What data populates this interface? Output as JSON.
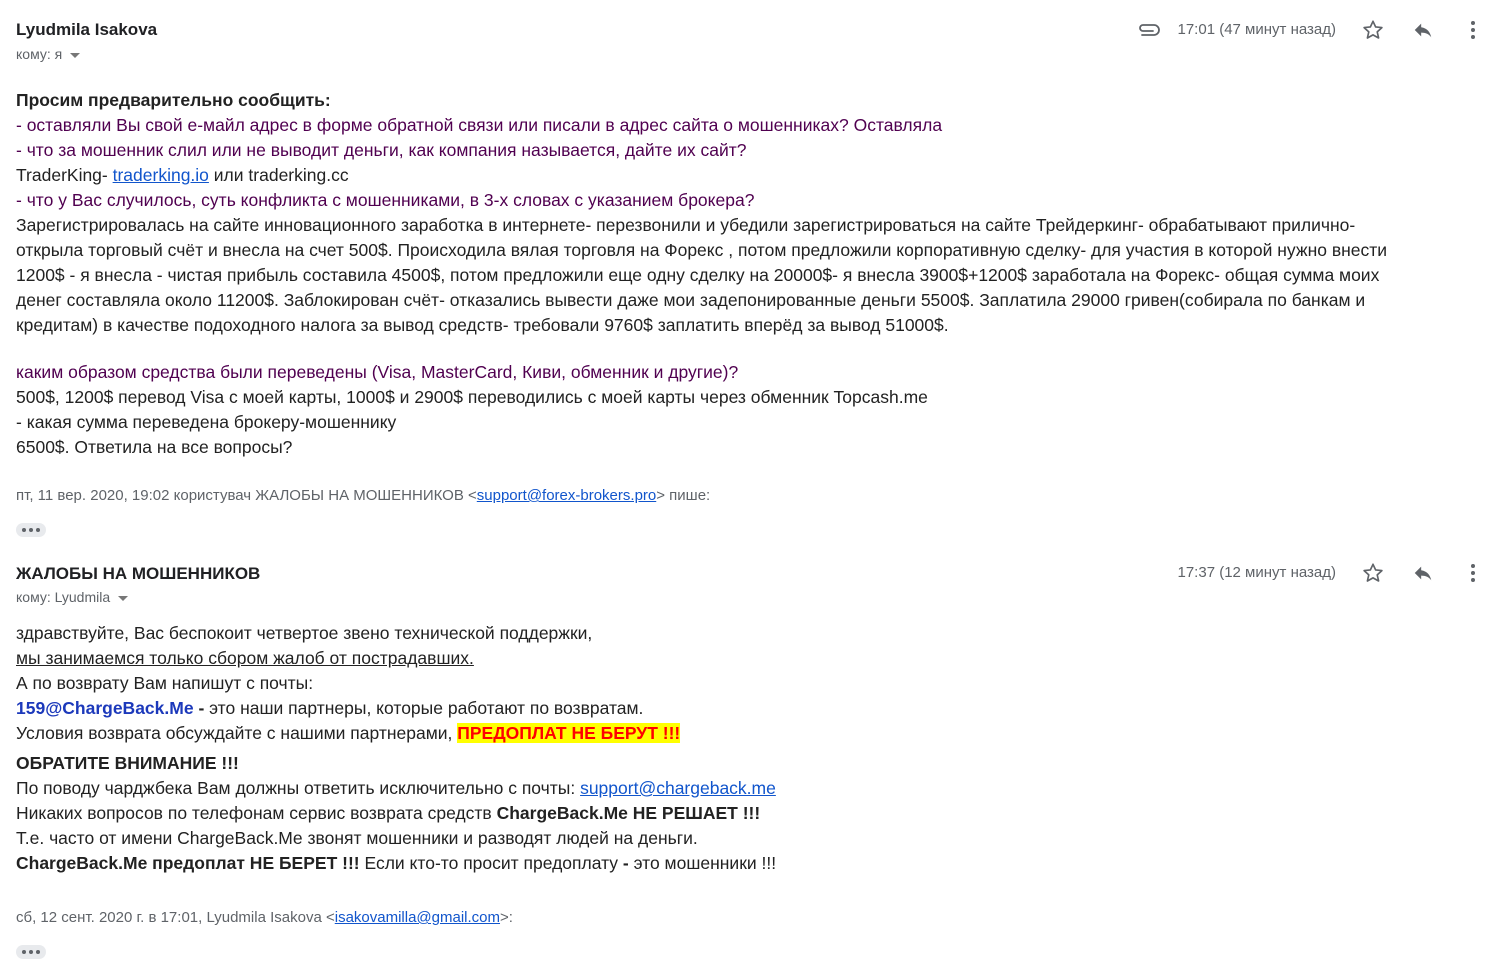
{
  "message1": {
    "sender": "Lyudmila Isakova",
    "recipient": "кому: я",
    "time": "17:01 (47 минут назад)",
    "icons": [
      "attachment-icon",
      "star-icon",
      "reply-icon",
      "more-vert-icon"
    ],
    "body": {
      "heading": "Просим предварительно сообщить:",
      "q1": " - оставляли Вы свой е-майл адрес в форме обратной связи или писали в адрес сайта о мошенниках? Оставляла",
      "q2": " - что за мошенник слил или не выводит деньги, как компания называется, дайте их сайт?",
      "a2_prefix": "TraderKing- ",
      "a2_link": "traderking.io",
      "a2_suffix": " или traderking.cc",
      "q3": " - что у Вас случилось, суть конфликта с мошенниками, в 3-х словах с указанием брокера?",
      "p1": "Зарегистрировалась на сайте инновационного заработка в интернете- перезвонили и убедили зарегистрироваться на сайте Трейдеркинг- обрабатывают прилично-",
      "p2": "открыла торговый счёт и внесла на счет 500$. Происходила вялая торговля на Форекс , потом предложили корпоративную сделку- для участия в которой нужно внести",
      "p3": "1200$ - я внесла - чистая прибыль составила 4500$, потом  предложили еще одну сделку на 20000$- я внесла 3900$+1200$ заработала на Форекс- общая сумма моих",
      "p4": "денег составляла около 11200$. Заблокирован счёт- отказались вывести даже мои задепонированные деньги 5500$. Заплатила 29000 гривен(собирала по банкам и",
      "p5": "кредитам) в качестве подоходного налога за вывод средств- требовали 9760$ заплатить вперёд за вывод 51000$.",
      "q4": "каким образом средства были переведены (Visa, MasterCard, Киви, обменник и другие)?",
      "a4": "500$, 1200$ перевод Visa с моей карты, 1000$ и 2900$ переводились с моей карты через обменник Topcash.me",
      "q5": " - какая сумма переведена брокеру-мошеннику",
      "a5": "6500$. Ответила на все вопросы?"
    },
    "quote_prefix": "пт, 11 вер. 2020, 19:02 користувач ЖАЛОБЫ НА МОШЕННИКОВ <",
    "quote_email": "support@forex-brokers.pro",
    "quote_suffix": "> пише:"
  },
  "message2": {
    "sender": "ЖАЛОБЫ НА МОШЕННИКОВ",
    "recipient": "кому: Lyudmila",
    "time": "17:37 (12 минут назад)",
    "icons": [
      "star-icon",
      "reply-icon",
      "more-vert-icon"
    ],
    "body": {
      "l1": "здравствуйте, Вас беспокоит четвертое звено технической поддержки,",
      "l2": "мы занимаемся только сбором жалоб от пострадавших.",
      "l3": "А по возврату Вам напишут с почты:",
      "l4_email": "159@ChargeBack.Me",
      "l4_dash": " - ",
      "l4_rest": "это наши партнеры, которые работают по возвратам.",
      "l5_text": "Условия возврата обсуждайте с нашими партнерами, ",
      "l5_highlight": "ПРЕДОПЛАТ НЕ БЕРУТ !!!",
      "l6": "ОБРАТИТЕ ВНИМАНИЕ !!!",
      "l7_text": "По поводу чарджбека Вам должны ответить исключительно с почты: ",
      "l7_link": "support@chargeback.me",
      "l8_text": "Никаких вопросов по телефонам сервис возврата средств ",
      "l8_bold": "ChargeBack.Me НЕ РЕШАЕТ !!!",
      "l9": "Т.е. часто от имени ChargeBack.Me звонят мошенники и разводят людей на деньги.",
      "l10_bold": "ChargeBack.Me предоплат НЕ БЕРЕТ !!!",
      "l10_text": " Если кто-то просит предоплату ",
      "l10_dash": "-",
      "l10_rest": " это мошенники !!!"
    },
    "quote_prefix": "сб, 12 сент. 2020 г. в 17:01, Lyudmila Isakova <",
    "quote_email": "isakovamilla@gmail.com",
    "quote_suffix": ">:"
  }
}
